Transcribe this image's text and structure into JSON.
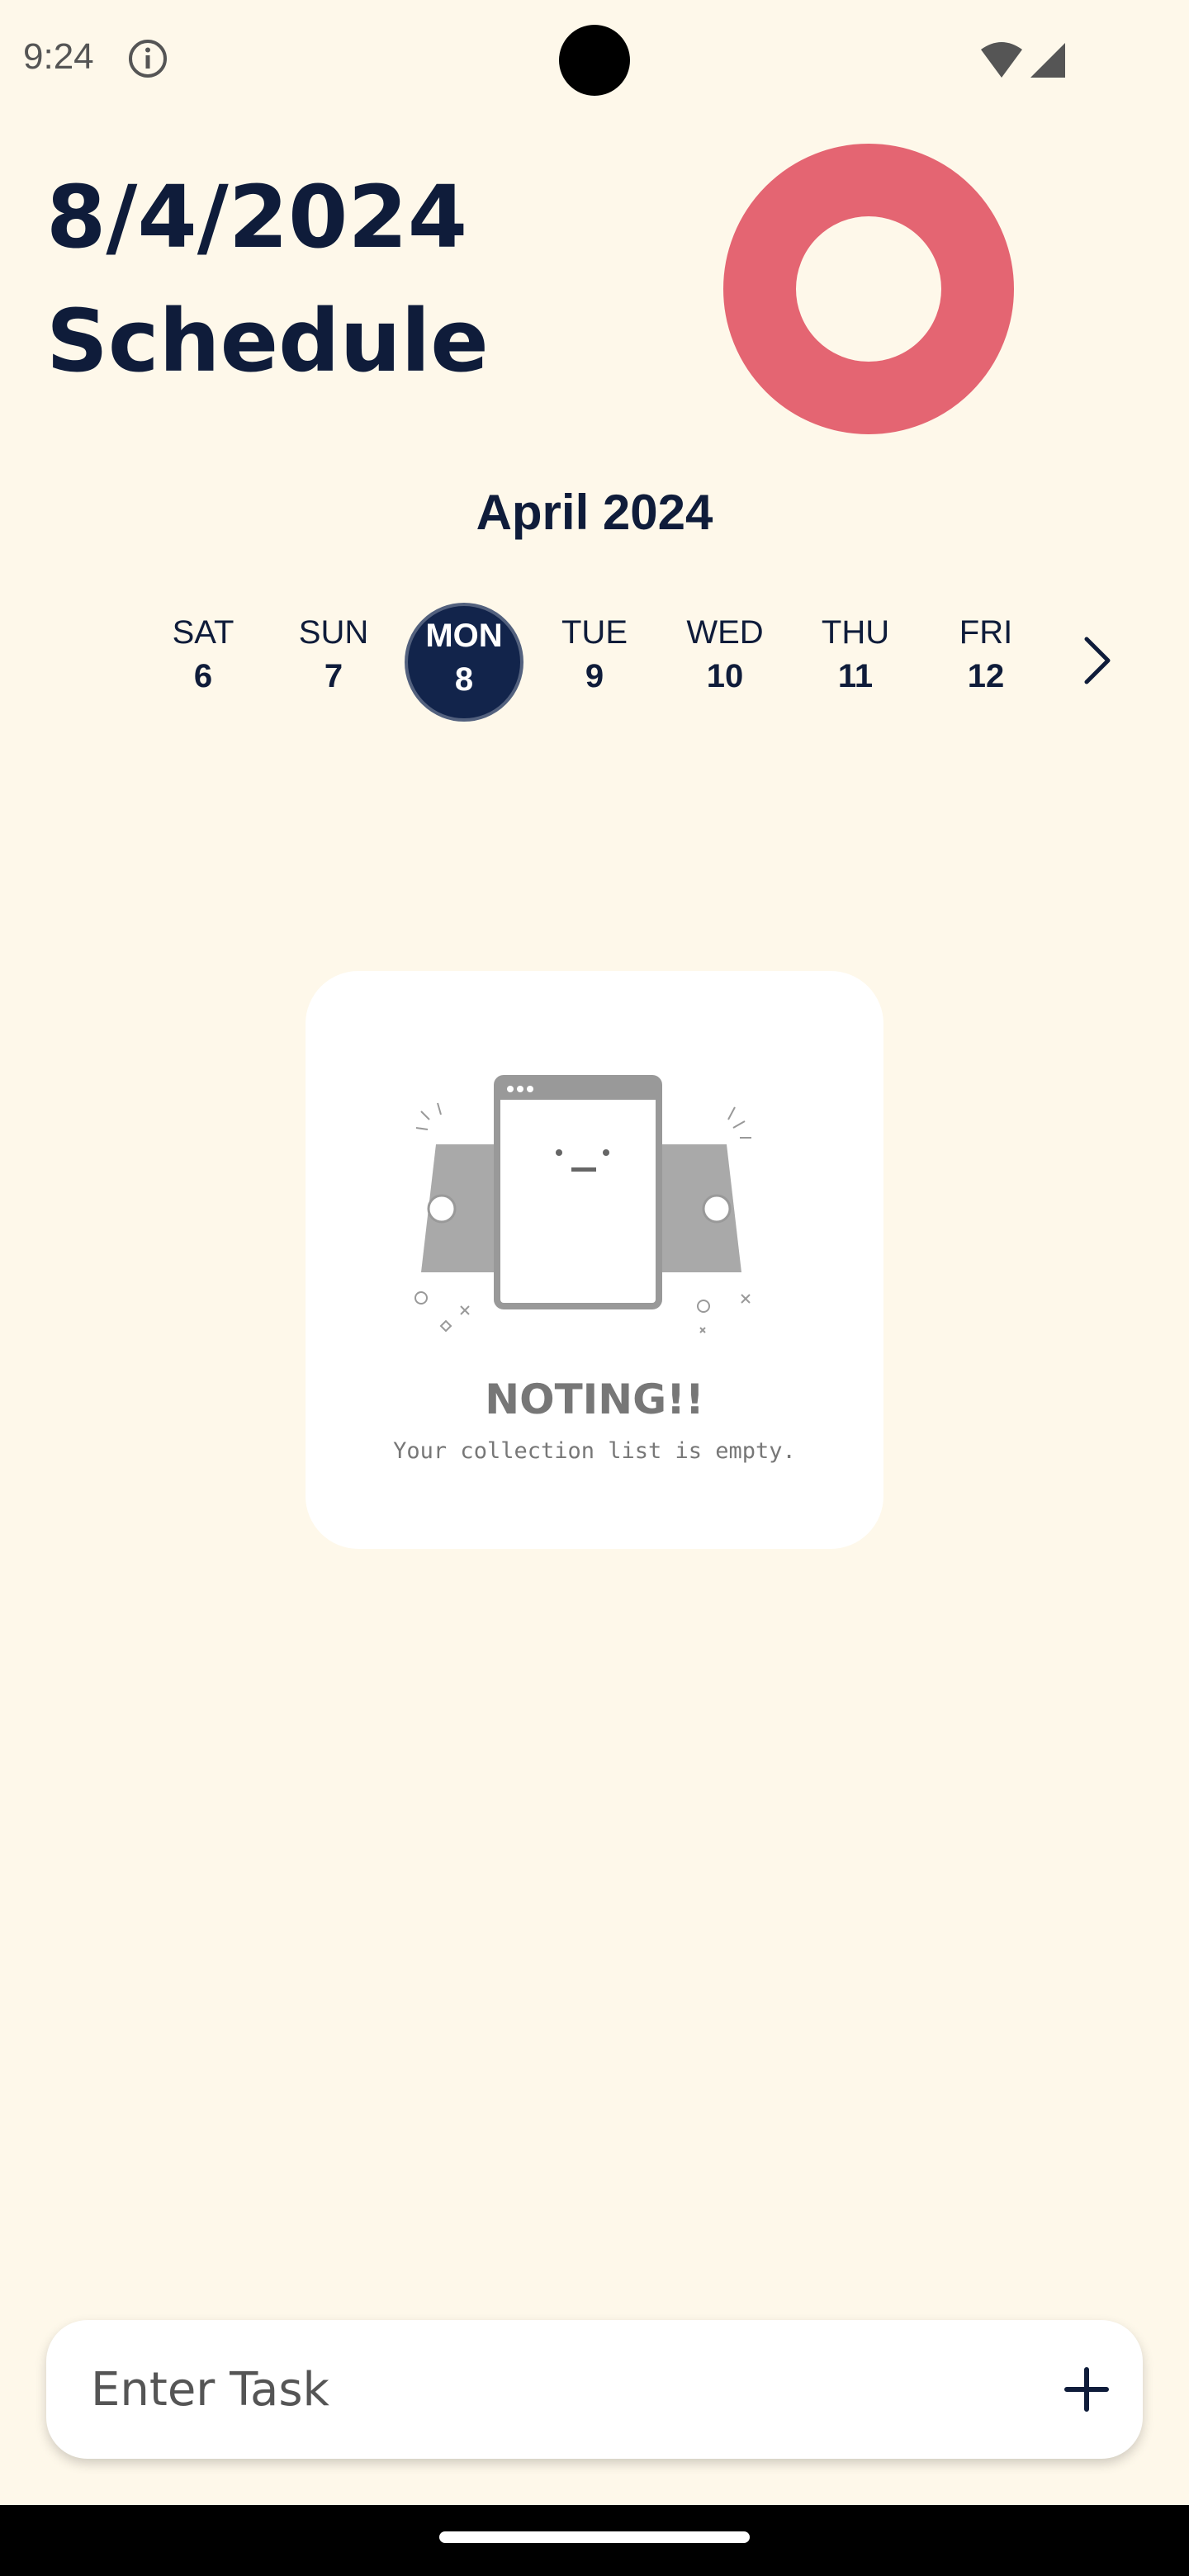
{
  "status_bar": {
    "time": "9:24"
  },
  "header": {
    "date": "8/4/2024",
    "title": "Schedule"
  },
  "progress": {
    "completed_fraction": 0,
    "ring_color": "#E46572"
  },
  "calendar": {
    "month": "April 2024",
    "days": [
      {
        "name": "SAT",
        "num": "6"
      },
      {
        "name": "SUN",
        "num": "7"
      },
      {
        "name": "MON",
        "num": "8",
        "selected": true
      },
      {
        "name": "TUE",
        "num": "9"
      },
      {
        "name": "WED",
        "num": "10"
      },
      {
        "name": "THU",
        "num": "11"
      },
      {
        "name": "FRI",
        "num": "12"
      }
    ]
  },
  "empty_state": {
    "title": "NOTING!!",
    "subtitle": "Your collection list is empty."
  },
  "task_input": {
    "placeholder": "Enter Task"
  },
  "colors": {
    "background": "#FEF8EA",
    "primary": "#0F1C3A",
    "accent": "#E46572"
  }
}
